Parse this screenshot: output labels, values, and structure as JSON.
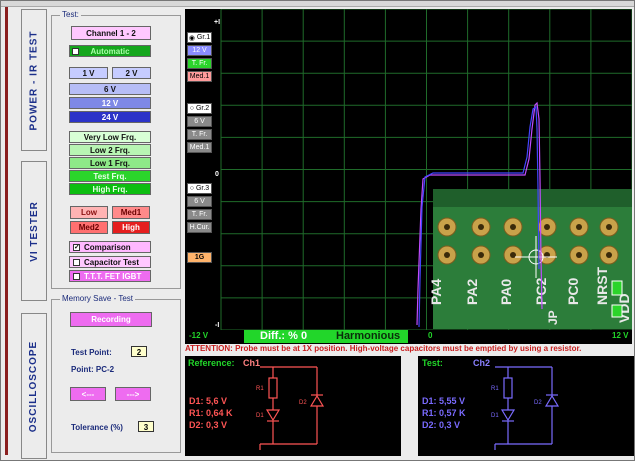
{
  "colors": {
    "ref": "#ff5555",
    "test": "#7a6bff",
    "green": "#22d62a",
    "grid": "#1f6b2a",
    "trace_ref": "#c04cff",
    "trace_test": "#4444ff",
    "board": "#2c7d3a"
  },
  "tabs": {
    "power_ir": "POWER - IR TEST",
    "vi_tester": "VI TESTER",
    "oscilloscope": "OSCILLOSCOPE"
  },
  "test_panel": {
    "legend": "Test:",
    "channel": "Channel 1 - 2",
    "automatic": "Automatic",
    "v1": "1 V",
    "v2": "2 V",
    "v6": "6 V",
    "v12": "12 V",
    "v24": "24 V",
    "freqs": [
      "Very Low Frq.",
      "Low 2 Frq.",
      "Low 1 Frq.",
      "Test Frq.",
      "High Frq."
    ],
    "levels": [
      "Low",
      "Med1",
      "Med2",
      "High"
    ],
    "comparison": "Comparison",
    "capacitor": "Capacitor Test",
    "ttt": "T.T.T. FET  IGBT"
  },
  "memory_panel": {
    "legend": "Memory Save - Test",
    "recording": "Recording",
    "test_point_label": "Test Point:",
    "test_point_value": "2",
    "point_label": "Point:  PC-2",
    "prev": "<---",
    "next": "--->",
    "tolerance_label": "Tolerance (%)",
    "tolerance_value": "3"
  },
  "scope": {
    "axis": {
      "top": "+I",
      "mid": "0",
      "bottom": "-I",
      "left": "-12 V",
      "center": "0",
      "right": "12 V"
    },
    "groups": [
      {
        "radio": "Gr.1",
        "items": [
          "12 V",
          "T. Fr.",
          "Med.1"
        ]
      },
      {
        "radio": "Gr.2",
        "items": [
          "6 V",
          "T. Fr.",
          "Med.1"
        ]
      },
      {
        "radio": "Gr.3",
        "items": [
          "6 V",
          "T. Fr.",
          "H.Cur."
        ]
      }
    ],
    "zoom": "1G",
    "pcb_labels": [
      "PA4",
      "PA2",
      "PA0",
      "PC2",
      "PC0",
      "NRST",
      "VDD"
    ],
    "pcb_jp": "JP"
  },
  "status": {
    "diff": "Diff.: % 0",
    "result": "Harmonious"
  },
  "attention": "ATTENTION: Probe must be at 1X position. High-voltage capacitors must be emptied by using a resistor.",
  "reference": {
    "title": "Reference:",
    "channel": "Ch1",
    "d1": "D1: 5,6 V",
    "r1": "R1: 0,64 K",
    "d2": "D2: 0,3 V",
    "lbl_r1": "R1",
    "lbl_d1": "D1",
    "lbl_d2": "D2"
  },
  "test": {
    "title": "Test:",
    "channel": "Ch2",
    "d1": "D1: 5,55 V",
    "r1": "R1: 0,57 K",
    "d2": "D2: 0,3 V",
    "lbl_r1": "R1",
    "lbl_d1": "D1",
    "lbl_d2": "D2"
  }
}
